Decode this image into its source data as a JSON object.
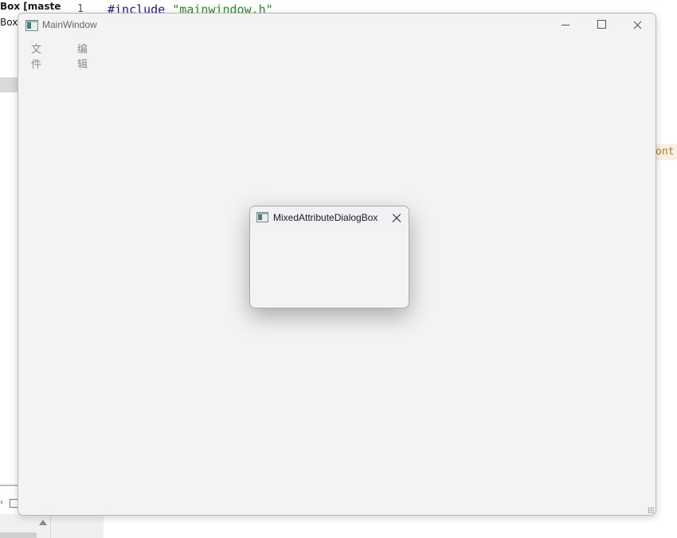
{
  "background": {
    "project_title": "Box [maste",
    "project_sub": "Box",
    "line_number": "1",
    "code_directive": "#include ",
    "code_string": "\"mainwindow.h\"",
    "right_snippet": "ont"
  },
  "main_window": {
    "title": "MainWindow",
    "menu": {
      "file": "文件",
      "edit": "编辑"
    }
  },
  "dialog": {
    "title": "MixedAttributeDialogBox"
  }
}
